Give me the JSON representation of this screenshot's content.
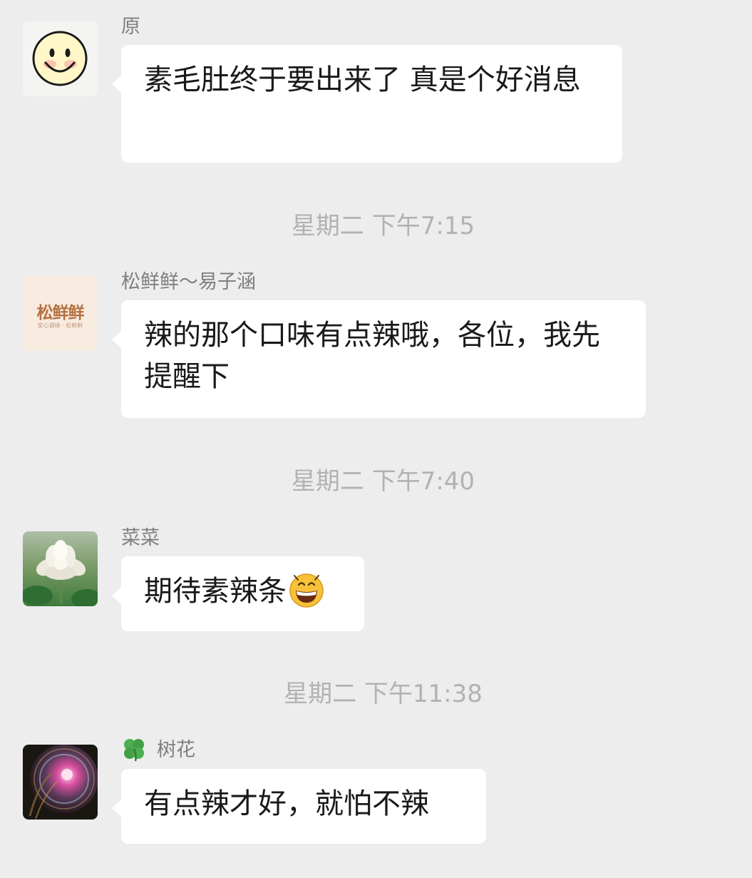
{
  "messages": [
    {
      "sender": "原",
      "text": "素毛肚终于要出来了 真是个好消息",
      "avatar_icon": "smiley-face-avatar"
    },
    {
      "sender": "松鲜鲜～易子涵",
      "text": "辣的那个口味有点辣哦，各位，我先提醒下",
      "avatar_icon": "brand-logo-avatar",
      "avatar_brand": "松鲜鲜",
      "avatar_tagline": "安心调味 · 松鲜鲜"
    },
    {
      "sender": "菜菜",
      "text": "期待素辣条",
      "avatar_icon": "white-flower-avatar",
      "trailing_emoji": "grinning-face-emoji"
    },
    {
      "sender": "树花",
      "sender_prefix_icon": "four-leaf-clover-icon",
      "text": "有点辣才好，就怕不辣",
      "avatar_icon": "cosmic-head-avatar"
    }
  ],
  "timestamps": [
    "星期二 下午7:15",
    "星期二 下午7:40",
    "星期二 下午11:38"
  ],
  "colors": {
    "background": "#ededed",
    "bubble": "#ffffff",
    "timestamp": "#b2b2b2",
    "sender": "#7f7f7f",
    "message_text": "#191919"
  }
}
